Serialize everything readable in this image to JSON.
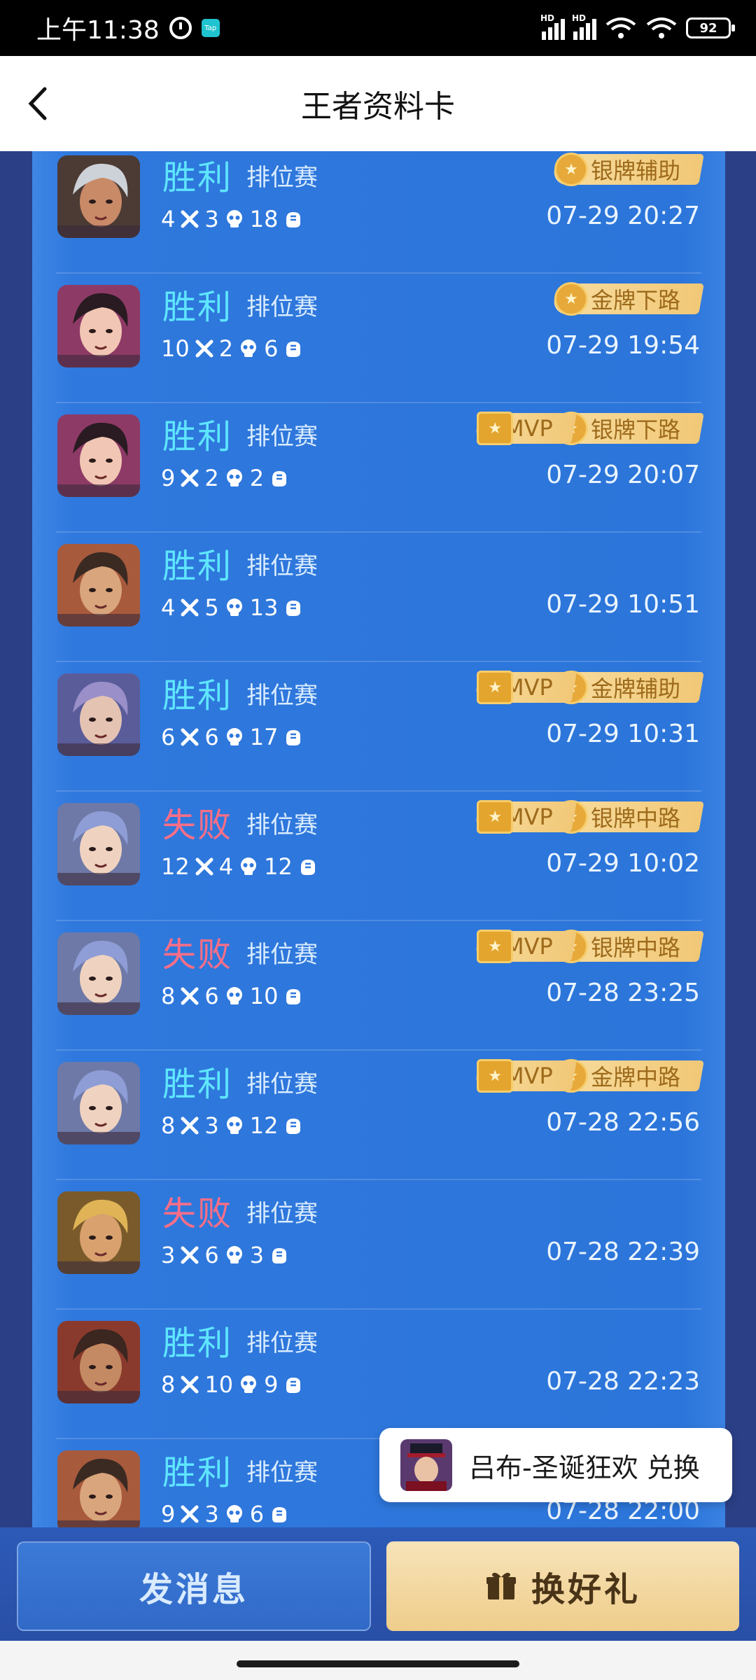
{
  "status_bar": {
    "time": "上午11:38",
    "tap_label": "Tap",
    "battery": "92"
  },
  "header": {
    "title": "王者资料卡"
  },
  "matches": [
    {
      "result": "胜利",
      "win": true,
      "mode": "排位赛",
      "kills": "4",
      "deaths": "3",
      "assists": "18",
      "time": "07-29 20:27",
      "mvp": false,
      "medal": "银牌辅助",
      "hair": "#cdd2d8",
      "skin": "#c98a68",
      "bg": "#4b3b34"
    },
    {
      "result": "胜利",
      "win": true,
      "mode": "排位赛",
      "kills": "10",
      "deaths": "2",
      "assists": "6",
      "time": "07-29 19:54",
      "mvp": false,
      "medal": "金牌下路",
      "hair": "#2a1b22",
      "skin": "#f2c6b4",
      "bg": "#8e3a66"
    },
    {
      "result": "胜利",
      "win": true,
      "mode": "排位赛",
      "kills": "9",
      "deaths": "2",
      "assists": "2",
      "time": "07-29 20:07",
      "mvp": true,
      "mvp_label": "MVP",
      "medal": "银牌下路",
      "hair": "#2a1b22",
      "skin": "#f2c6b4",
      "bg": "#8e3a66"
    },
    {
      "result": "胜利",
      "win": true,
      "mode": "排位赛",
      "kills": "4",
      "deaths": "5",
      "assists": "13",
      "time": "07-29 10:51",
      "mvp": false,
      "medal": "",
      "hair": "#3a2a22",
      "skin": "#d9a57c",
      "bg": "#a85a3c"
    },
    {
      "result": "胜利",
      "win": true,
      "mode": "排位赛",
      "kills": "6",
      "deaths": "6",
      "assists": "17",
      "time": "07-29 10:31",
      "mvp": true,
      "mvp_label": "MVP",
      "medal": "金牌辅助",
      "hair": "#9a8fc9",
      "skin": "#e4c3b3",
      "bg": "#5a5c9a"
    },
    {
      "result": "失败",
      "win": false,
      "mode": "排位赛",
      "kills": "12",
      "deaths": "4",
      "assists": "12",
      "time": "07-29 10:02",
      "mvp": true,
      "mvp_label": "MVP",
      "medal": "银牌中路",
      "hair": "#8e9dd6",
      "skin": "#efd3c0",
      "bg": "#6e79a7"
    },
    {
      "result": "失败",
      "win": false,
      "mode": "排位赛",
      "kills": "8",
      "deaths": "6",
      "assists": "10",
      "time": "07-28 23:25",
      "mvp": true,
      "mvp_label": "MVP",
      "medal": "银牌中路",
      "hair": "#8e9dd6",
      "skin": "#efd3c0",
      "bg": "#6e79a7"
    },
    {
      "result": "胜利",
      "win": true,
      "mode": "排位赛",
      "kills": "8",
      "deaths": "3",
      "assists": "12",
      "time": "07-28 22:56",
      "mvp": true,
      "mvp_label": "MVP",
      "medal": "金牌中路",
      "hair": "#8e9dd6",
      "skin": "#efd3c0",
      "bg": "#6e79a7"
    },
    {
      "result": "失败",
      "win": false,
      "mode": "排位赛",
      "kills": "3",
      "deaths": "6",
      "assists": "3",
      "time": "07-28 22:39",
      "mvp": false,
      "medal": "",
      "hair": "#e0b456",
      "skin": "#d8a16d",
      "bg": "#7a5a2a"
    },
    {
      "result": "胜利",
      "win": true,
      "mode": "排位赛",
      "kills": "8",
      "deaths": "10",
      "assists": "9",
      "time": "07-28 22:23",
      "mvp": false,
      "medal": "",
      "hair": "#3b2620",
      "skin": "#c48a63",
      "bg": "#8a3a2c"
    },
    {
      "result": "胜利",
      "win": true,
      "mode": "排位赛",
      "kills": "9",
      "deaths": "3",
      "assists": "6",
      "time": "07-28 22:00",
      "mvp": false,
      "medal": "",
      "hair": "#3a2a22",
      "skin": "#d9a57c",
      "bg": "#a85a3c"
    }
  ],
  "toast": {
    "text": "吕布-圣诞狂欢 兑换"
  },
  "bottom": {
    "message_label": "发消息",
    "gift_label": "换好礼"
  },
  "colors": {
    "win": "#5fe6ff",
    "lose": "#ff6e86",
    "panel": "#2f78dd"
  }
}
